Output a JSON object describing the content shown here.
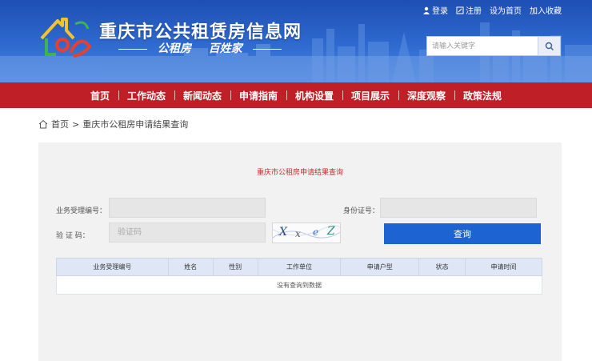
{
  "header": {
    "site_title": "重庆市公共租赁房信息网",
    "slogan_left": "公租房",
    "slogan_right": "百姓家",
    "top_links": {
      "login": "登录",
      "register": "注册",
      "set_home": "设为首页",
      "bookmark": "加入收藏"
    },
    "search": {
      "placeholder": "请输入关键字"
    }
  },
  "nav": {
    "items": [
      "首页",
      "工作动态",
      "新闻动态",
      "申请指南",
      "机构设置",
      "项目展示",
      "深度观察",
      "政策法规"
    ]
  },
  "breadcrumb": {
    "home": "首页",
    "separator": ">",
    "current": "重庆市公租房申请结果查询"
  },
  "form": {
    "title": "重庆市公租房申请结果查询",
    "business_no_label": "业务受理编号：",
    "id_card_label": "身份证号：",
    "captcha_label": "验 证 码：",
    "captcha_placeholder": "验证码",
    "captcha_chars": [
      "X",
      "x",
      "e",
      "Z"
    ],
    "query_button": "查询"
  },
  "table": {
    "headers": [
      "业务受理编号",
      "姓名",
      "性别",
      "工作单位",
      "申请户型",
      "状态",
      "申请时间"
    ],
    "empty_text": "没有查询到数据"
  },
  "colors": {
    "header_blue": "#2f6ad0",
    "nav_red": "#bf1f27",
    "title_red": "#d0282c",
    "button_blue": "#1e63d2"
  }
}
